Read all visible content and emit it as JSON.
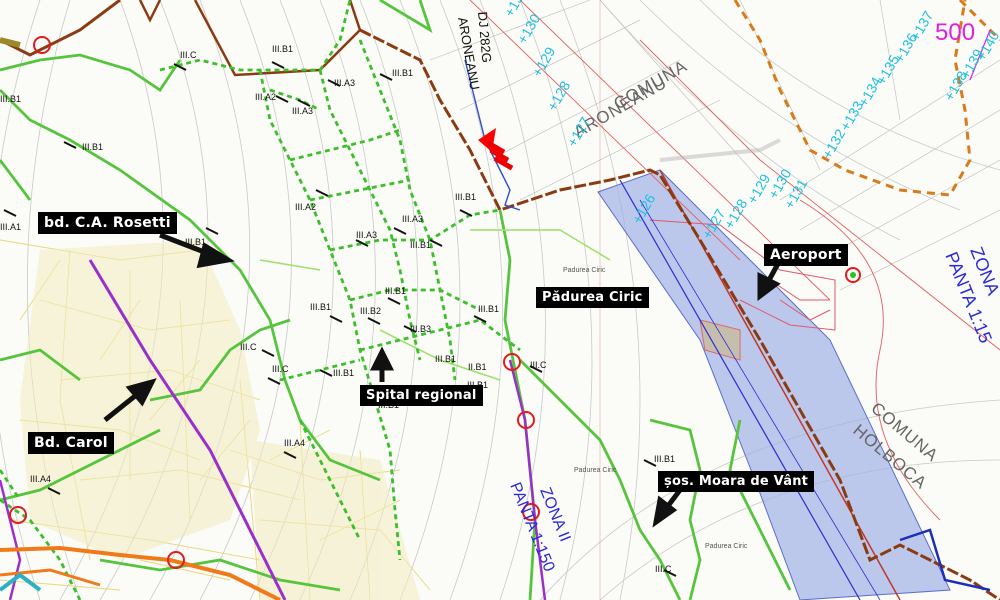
{
  "callouts": {
    "rosetti": "bd. C.A. Rosetti",
    "carol": "Bd. Carol",
    "spital": "Spital regional",
    "padurea": "Pădurea Ciric",
    "aeroport": "Aeroport",
    "moara": "șos. Moara de Vânt"
  },
  "labels": {
    "comuna_aroneanu": [
      "COMUNA",
      "ARONEANU"
    ],
    "comuna_holboca": [
      "COMUNA",
      "HOLBOCA"
    ],
    "zona_ii": "ZONA II",
    "panta_150": "PANTA 1:150",
    "zona_right": "ZONA",
    "panta_right": "PANTA 1:15",
    "dj": "DJ 282G",
    "aroneanu_road": "ARONEANU",
    "magenta_num": "500",
    "padurea_ciric_small": "Padurea Ciric"
  },
  "elevations": [
    "+131",
    "+130",
    "+129",
    "+128",
    "+127",
    "+126",
    "+132",
    "+133",
    "+134",
    "+135",
    "+136",
    "+137",
    "+138",
    "+139",
    "+140",
    "+131",
    "+130",
    "+129",
    "+128",
    "+127"
  ],
  "segments": [
    "III.C",
    "III.B1",
    "III.A3",
    "III.B1",
    "III.A2",
    "III.A3",
    "III.B1",
    "III.B1",
    "III.A2",
    "III.A3",
    "III.A3",
    "III.B1",
    "III.B1",
    "III.B1",
    "III.B2",
    "III.B3",
    "III.B1",
    "III.C",
    "III.C",
    "III.B1",
    "III.A4",
    "III.A4",
    "III.C",
    "III.C",
    "III.B1",
    "II.B1",
    "III.B1",
    "III.B1",
    "III.A1",
    "III.B1",
    "III.B1",
    "III.B1"
  ]
}
